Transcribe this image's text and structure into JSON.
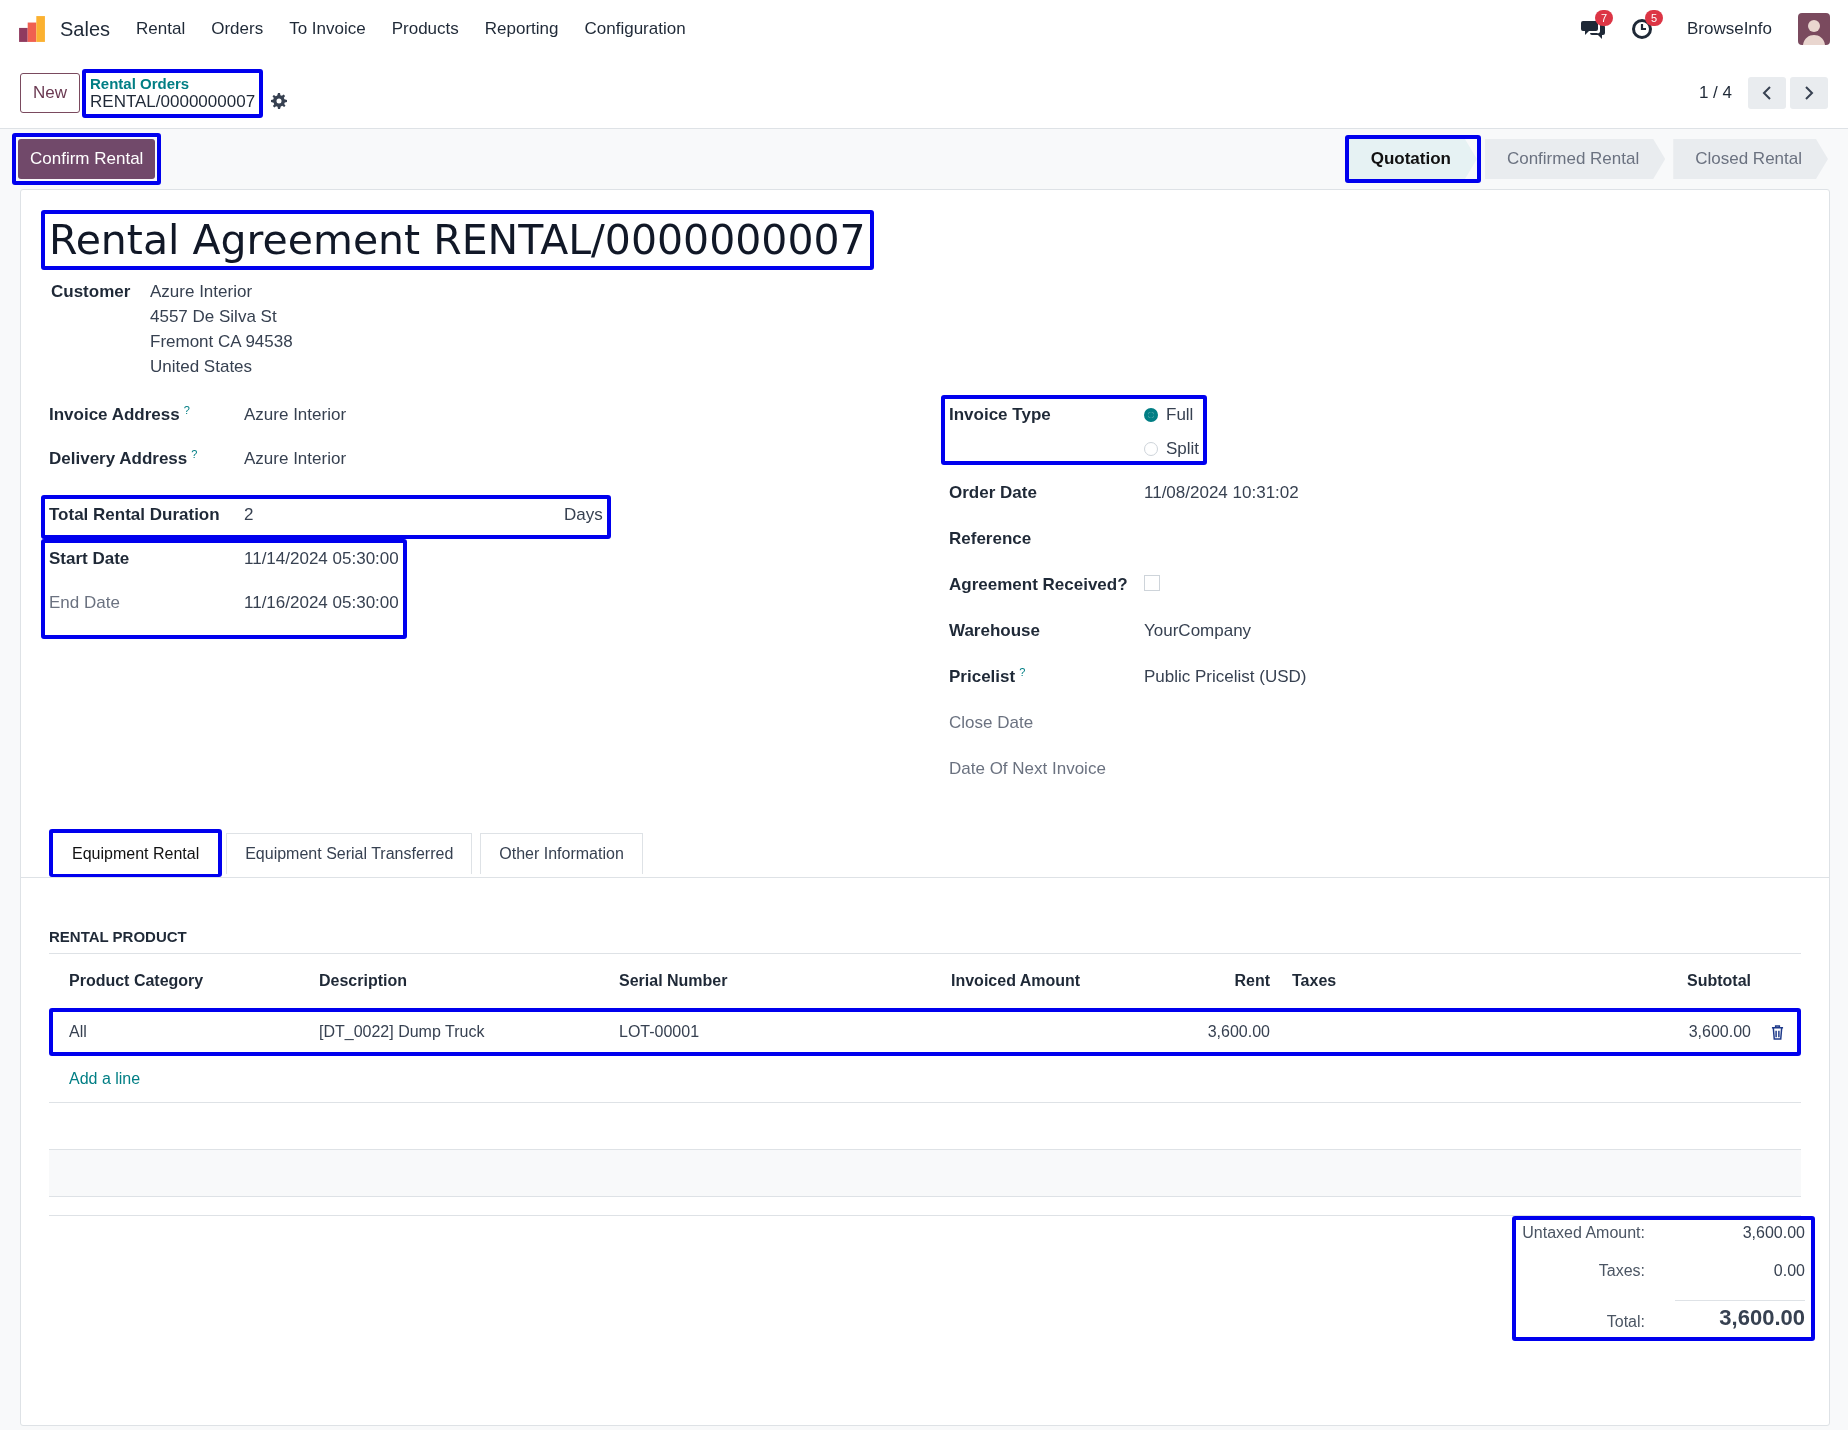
{
  "navbar": {
    "app": "Sales",
    "menu": [
      "Rental",
      "Orders",
      "To Invoice",
      "Products",
      "Reporting",
      "Configuration"
    ],
    "messages_badge": "7",
    "activities_badge": "5",
    "user": "BrowseInfo"
  },
  "control_panel": {
    "new_button": "New",
    "breadcrumb": {
      "parent": "Rental Orders",
      "current": "RENTAL/0000000007",
      "highlighted": true
    },
    "pager": "1 / 4"
  },
  "status_bar": {
    "action": {
      "label": "Confirm Rental",
      "highlighted": true
    },
    "stages": [
      {
        "label": "Quotation",
        "selected": true,
        "highlighted": true
      },
      {
        "label": "Confirmed Rental",
        "selected": false,
        "highlighted": false
      },
      {
        "label": "Closed Rental",
        "selected": false,
        "highlighted": false
      }
    ]
  },
  "form": {
    "title": {
      "text": "Rental Agreement RENTAL/0000000007",
      "highlighted": true
    },
    "customer": {
      "label": "Customer",
      "lines": [
        "Azure Interior",
        "4557 De Silva St",
        "Fremont CA 94538",
        "United States"
      ]
    },
    "left_groups": [
      {
        "highlighted": false,
        "fields": [
          {
            "kind": "text",
            "label": "Invoice Address",
            "help": "?",
            "muted": false,
            "value": "Azure Interior"
          },
          {
            "kind": "text",
            "label": "Delivery Address",
            "help": "?",
            "muted": false,
            "value": "Azure Interior"
          }
        ]
      },
      {
        "highlighted": true,
        "fields": [
          {
            "kind": "duration",
            "label": "Total Rental Duration",
            "muted": false,
            "value": "2",
            "unit": "Days"
          }
        ]
      },
      {
        "highlighted": true,
        "fields": [
          {
            "kind": "text",
            "label": "Start Date",
            "muted": false,
            "value": "11/14/2024 05:30:00"
          },
          {
            "kind": "text",
            "label": "End Date",
            "muted": true,
            "value": "11/16/2024 05:30:00"
          }
        ]
      }
    ],
    "right_groups": [
      {
        "highlighted": true,
        "fields": [
          {
            "kind": "radio",
            "label": "Invoice Type",
            "muted": false,
            "options": [
              {
                "label": "Full",
                "selected": true
              },
              {
                "label": "Split",
                "selected": false
              }
            ]
          }
        ]
      },
      {
        "highlighted": false,
        "fields": [
          {
            "kind": "text",
            "label": "Order Date",
            "muted": false,
            "value": "11/08/2024 10:31:02"
          },
          {
            "kind": "text",
            "label": "Reference",
            "muted": false
          },
          {
            "kind": "checkbox",
            "label": "Agreement Received?",
            "muted": false,
            "checked": false
          },
          {
            "kind": "text",
            "label": "Warehouse",
            "muted": false,
            "value": "YourCompany"
          },
          {
            "kind": "text",
            "label": "Pricelist",
            "help": "?",
            "muted": false,
            "value": "Public Pricelist (USD)"
          },
          {
            "kind": "text",
            "label": "Close Date",
            "muted": true
          },
          {
            "kind": "text",
            "label": "Date Of Next Invoice",
            "muted": true
          }
        ]
      }
    ]
  },
  "tabs": [
    {
      "label": "Equipment Rental",
      "selected": true,
      "highlighted": true
    },
    {
      "label": "Equipment Serial Transferred",
      "selected": false,
      "highlighted": false
    },
    {
      "label": "Other Information",
      "selected": false,
      "highlighted": false
    }
  ],
  "table": {
    "section": "RENTAL PRODUCT",
    "columns": [
      {
        "label": "Product Category",
        "kind": "text"
      },
      {
        "label": "Description",
        "kind": "text"
      },
      {
        "label": "Serial Number",
        "kind": "text"
      },
      {
        "label": "Invoiced Amount",
        "kind": "text"
      },
      {
        "label": "Rent",
        "kind": "number"
      },
      {
        "label": "Taxes",
        "kind": "text"
      },
      {
        "label": "Subtotal",
        "kind": "number"
      }
    ],
    "rows": [
      {
        "highlighted": true,
        "cells": [
          "All",
          "[DT_0022] Dump Truck",
          "LOT-00001",
          null,
          "3,600.00",
          null,
          "3,600.00"
        ]
      }
    ],
    "add_line": "Add a line"
  },
  "totals": {
    "highlighted": true,
    "lines": [
      {
        "kind": "normal",
        "label": "Untaxed Amount:",
        "value": "3,600.00"
      },
      {
        "kind": "normal",
        "label": "Taxes:",
        "value": "0.00"
      },
      {
        "kind": "grand",
        "label": "Total:",
        "value": "3,600.00"
      }
    ]
  }
}
